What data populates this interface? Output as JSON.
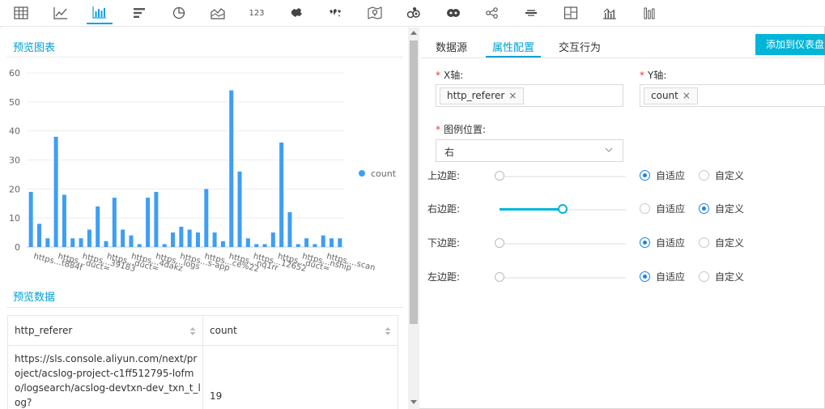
{
  "toolbar": {
    "icons": [
      "table-icon",
      "line-chart-icon",
      "bar-chart-icon",
      "horizontal-bar-icon",
      "pie-chart-icon",
      "area-chart-icon",
      "number-icon",
      "china-map-icon",
      "world-map-icon",
      "map-pin-icon",
      "flow-icon",
      "heatmap-icon",
      "tree-icon",
      "word-cloud-icon",
      "layout-icon",
      "radar-icon",
      "column-icon"
    ],
    "number_label": "123",
    "word_label": "word cloud",
    "active_index": 2,
    "accent": "#00a0e9"
  },
  "preview_chart": {
    "title": "预览图表"
  },
  "preview_data": {
    "title": "预览数据"
  },
  "chart_data": {
    "type": "bar",
    "yticks": [
      0,
      10,
      20,
      30,
      40,
      50,
      60
    ],
    "ylim": [
      0,
      60
    ],
    "values": [
      19,
      8,
      3,
      38,
      18,
      3,
      3,
      6,
      14,
      2,
      17,
      6,
      4,
      1,
      17,
      19,
      1,
      5,
      7,
      6,
      5,
      20,
      5,
      2,
      54,
      26,
      3,
      1,
      1,
      5,
      36,
      12,
      1,
      3,
      1,
      4,
      3,
      3
    ],
    "xticks": [
      "https...t884f",
      "https...duct=",
      "https...39183",
      "https...duct=",
      "https...4dakz",
      "https...logs",
      "https...s-app",
      "https...ce%22",
      "https...nq1rr",
      "https...12652",
      "https...duct=",
      "https...nship",
      "https....scan"
    ],
    "legend": {
      "label": "count",
      "position": "right"
    },
    "bar_color": "#3d9ef5",
    "grid": true
  },
  "table": {
    "columns": [
      "http_referer",
      "count"
    ],
    "rows": [
      {
        "http_referer": "https://sls.console.aliyun.com/next/project/acslog-project-c1ff512795-lofmo/logsearch/acslog-devtxn-dev_txn_t_log?",
        "count": "19"
      }
    ]
  },
  "right": {
    "tabs": [
      "数据源",
      "属性配置",
      "交互行为"
    ],
    "active_tab": 1,
    "add_button": "添加到仪表盘",
    "x_axis": {
      "label": "X轴:",
      "tag": "http_referer"
    },
    "y_axis": {
      "label": "Y轴:",
      "tag": "count"
    },
    "legend_position": {
      "label": "图例位置:",
      "value": "右"
    },
    "margins": [
      {
        "label": "上边距:",
        "mode": "auto",
        "value": 0
      },
      {
        "label": "右边距:",
        "mode": "custom",
        "value": 0.5
      },
      {
        "label": "下边距:",
        "mode": "auto",
        "value": 0
      },
      {
        "label": "左边距:",
        "mode": "auto",
        "value": 0
      }
    ],
    "auto_label": "自适应",
    "custom_label": "自定义",
    "req_mark": "*"
  }
}
